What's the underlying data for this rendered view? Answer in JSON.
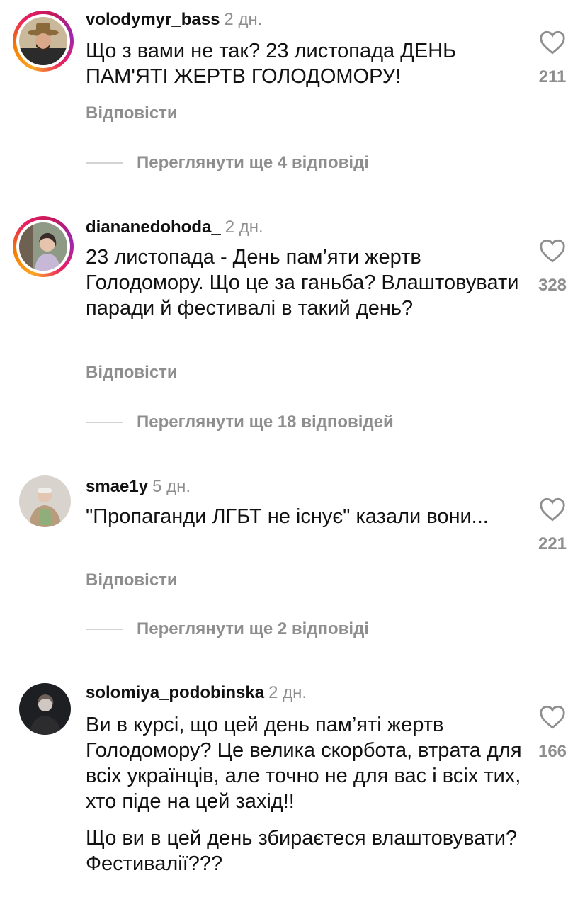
{
  "comments": [
    {
      "username": "volodymyr_bass",
      "time": "2 дн.",
      "lines": [
        "Що з вами не так? 23 листопада ДЕНЬ ПАМ'ЯТІ ЖЕРТВ ГОЛОДОМОРУ!"
      ],
      "likes": "211",
      "reply_label": "Відповісти",
      "view_replies": "Переглянути ще 4 відповіді",
      "has_story": true
    },
    {
      "username": "diananedohoda_",
      "time": "2 дн.",
      "lines": [
        "23 листопада - День пам’яти жертв Голодомору. Що це за ганьба? Влаштовувати паради й фестивалі в такий день?"
      ],
      "likes": "328",
      "reply_label": "Відповісти",
      "view_replies": "Переглянути ще 18 відповідей",
      "has_story": true
    },
    {
      "username": "smae1y",
      "time": "5 дн.",
      "lines": [
        "\"Пропаганди ЛГБТ не існує\" казали вони..."
      ],
      "likes": "221",
      "reply_label": "Відповісти",
      "view_replies": "Переглянути ще 2 відповіді",
      "has_story": false
    },
    {
      "username": "solomiya_podobinska",
      "time": "2 дн.",
      "lines": [
        "Ви в курсі, що цей день пам’яті жертв Голодомору? Це велика скорбота, втрата для всіх українців, але точно не для вас і всіх тих, хто піде на цей захід!!",
        "Що ви в цей день збираєтеся влаштовувати? Фестивалії???"
      ],
      "likes": "166",
      "has_story": false
    }
  ],
  "icons": {
    "like": "heart-outline-icon"
  },
  "colors": {
    "text": "#111111",
    "secondary": "#8e8e8e"
  }
}
